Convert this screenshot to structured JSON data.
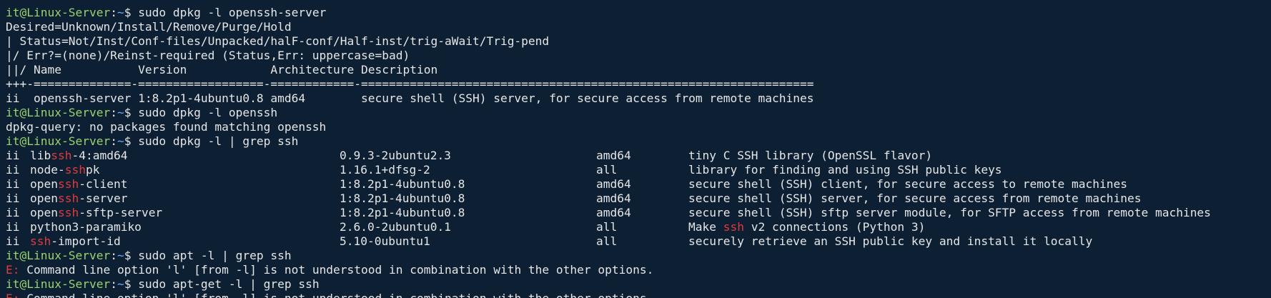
{
  "terminal": {
    "prompt": {
      "user_host": "it@Linux-Server",
      "sep": ":",
      "path": "~",
      "symbol": "$ "
    },
    "colors": {
      "background": "#0c1f33",
      "text": "#e6e6e6",
      "prompt_user": "#9ad26d",
      "prompt_path": "#6fa8ff",
      "highlight": "#e03b3b"
    },
    "cmd1": "sudo dpkg -l openssh-server",
    "hdr1": "Desired=Unknown/Install/Remove/Purge/Hold",
    "hdr2": "| Status=Not/Inst/Conf-files/Unpacked/halF-conf/Half-inst/trig-aWait/Trig-pend",
    "hdr3": "|/ Err?=(none)/Reinst-required (Status,Err: uppercase=bad)",
    "hdr4": "||/ Name           Version            Architecture Description",
    "hdr5": "+++-==============-==================-============-=================================================================",
    "pkg1": "ii  openssh-server 1:8.2p1-4ubuntu0.8 amd64        secure shell (SSH) server, for secure access from remote machines",
    "cmd2": "sudo dpkg -l openssh",
    "out2": "dpkg-query: no packages found matching openssh",
    "cmd3": "sudo dpkg -l | grep ssh",
    "grep_rows": [
      {
        "status": "ii",
        "name_pre": "lib",
        "name_match": "ssh",
        "name_post": "-4:amd64",
        "version": "0.9.3-2ubuntu2.3",
        "arch": "amd64",
        "desc_pre": "tiny C SSH library (OpenSSL flavor)",
        "desc_match": "",
        "desc_post": ""
      },
      {
        "status": "ii",
        "name_pre": "node-",
        "name_match": "ssh",
        "name_post": "pk",
        "version": "1.16.1+dfsg-2",
        "arch": "all",
        "desc_pre": "library for finding and using SSH public keys",
        "desc_match": "",
        "desc_post": ""
      },
      {
        "status": "ii",
        "name_pre": "open",
        "name_match": "ssh",
        "name_post": "-client",
        "version": "1:8.2p1-4ubuntu0.8",
        "arch": "amd64",
        "desc_pre": "secure shell (SSH) client, for secure access to remote machines",
        "desc_match": "",
        "desc_post": ""
      },
      {
        "status": "ii",
        "name_pre": "open",
        "name_match": "ssh",
        "name_post": "-server",
        "version": "1:8.2p1-4ubuntu0.8",
        "arch": "amd64",
        "desc_pre": "secure shell (SSH) server, for secure access from remote machines",
        "desc_match": "",
        "desc_post": ""
      },
      {
        "status": "ii",
        "name_pre": "open",
        "name_match": "ssh",
        "name_post": "-sftp-server",
        "version": "1:8.2p1-4ubuntu0.8",
        "arch": "amd64",
        "desc_pre": "secure shell (SSH) sftp server module, for SFTP access from remote machines",
        "desc_match": "",
        "desc_post": ""
      },
      {
        "status": "ii",
        "name_pre": "python3-paramiko",
        "name_match": "",
        "name_post": "",
        "version": "2.6.0-2ubuntu0.1",
        "arch": "all",
        "desc_pre": "Make ",
        "desc_match": "ssh",
        "desc_post": " v2 connections (Python 3)"
      },
      {
        "status": "ii",
        "name_pre": "",
        "name_match": "ssh",
        "name_post": "-import-id",
        "version": "5.10-0ubuntu1",
        "arch": "all",
        "desc_pre": "securely retrieve an SSH public key and install it locally",
        "desc_match": "",
        "desc_post": ""
      }
    ],
    "cmd4": "sudo apt -l | grep ssh",
    "err4_label": "E:",
    "err4_text": " Command line option 'l' [from -l] is not understood in combination with the other options.",
    "cmd5": "sudo apt-get -l | grep ssh",
    "err5_label": "E:",
    "err5_text": " Command line option 'l' [from -l] is not understood in combination with the other options."
  }
}
